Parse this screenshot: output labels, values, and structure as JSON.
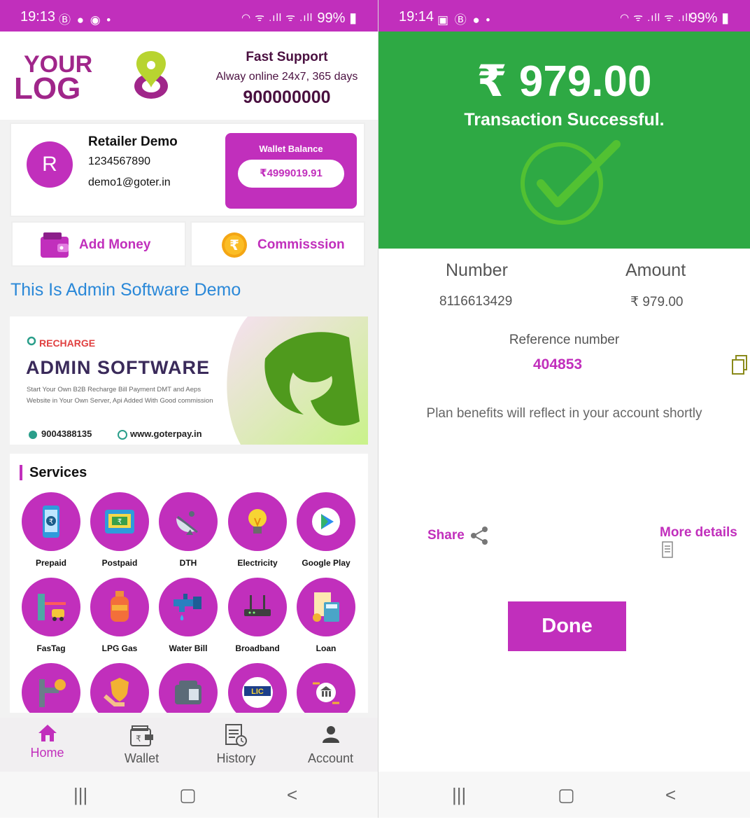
{
  "left": {
    "status": {
      "time": "19:13",
      "battery": "99%"
    },
    "header": {
      "logo_text_top": "YOUR",
      "logo_text_bottom": "LOG",
      "support_title": "Fast Support",
      "support_sub": "Alway online 24x7, 365 days",
      "support_phone": "900000000"
    },
    "profile": {
      "initial": "R",
      "name": "Retailer Demo",
      "phone": "1234567890",
      "email": "demo1@goter.in",
      "wallet_label": "Wallet Balance",
      "wallet_value": "₹4999019.91"
    },
    "actions": {
      "add_money": "Add Money",
      "commission": "Commisssion"
    },
    "admin_title": "This Is Admin Software  Demo",
    "banner": {
      "tag": "RECHARGE",
      "title": "ADMIN SOFTWARE",
      "desc": "Start Your Own B2B Recharge Bill Payment DMT and Aeps Website in Your Own Server, Api Added With Good commission",
      "phone": "9004388135",
      "site": "www.goterpay.in"
    },
    "services": {
      "title": "Services",
      "items": [
        {
          "label": "Prepaid",
          "icon": "mobile-icon"
        },
        {
          "label": "Postpaid",
          "icon": "phone-bill-icon"
        },
        {
          "label": "DTH",
          "icon": "satellite-dish-icon"
        },
        {
          "label": "Electricity",
          "icon": "bulb-icon"
        },
        {
          "label": "Google Play",
          "icon": "play-icon"
        },
        {
          "label": "FasTag",
          "icon": "toll-icon"
        },
        {
          "label": "LPG Gas",
          "icon": "gas-cylinder-icon"
        },
        {
          "label": "Water Bill",
          "icon": "tap-icon"
        },
        {
          "label": "Broadband",
          "icon": "router-icon"
        },
        {
          "label": "Loan",
          "icon": "calculator-icon"
        }
      ],
      "row3_lic_text": "LIC"
    },
    "nav": [
      {
        "label": "Home",
        "active": true
      },
      {
        "label": "Wallet",
        "active": false
      },
      {
        "label": "History",
        "active": false
      },
      {
        "label": "Account",
        "active": false
      }
    ]
  },
  "right": {
    "status": {
      "time": "19:14",
      "battery": "99%"
    },
    "amount": "₹ 979.00",
    "message": "Transaction Successful.",
    "number_label": "Number",
    "number_value": "8116613429",
    "amount_label": "Amount",
    "amount_value": "₹ 979.00",
    "ref_label": "Reference number",
    "ref_value": "404853",
    "plan_msg": "Plan benefits will reflect in your account shortly",
    "share_label": "Share",
    "more_label": "More details",
    "done_label": "Done"
  },
  "colors": {
    "brand": "#c12fbc",
    "success": "#2ea944",
    "link_blue": "#2a88d8"
  }
}
